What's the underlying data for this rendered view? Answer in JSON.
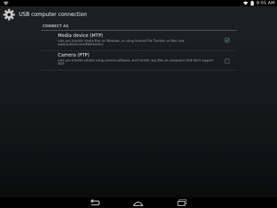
{
  "status_bar": {
    "time": "9:05 AM",
    "wifi_icon": "wifi-icon",
    "battery_icon": "battery-icon"
  },
  "action_bar": {
    "title": "USB computer connection",
    "icon": "settings-gear-icon"
  },
  "section": {
    "header": "CONNECT AS"
  },
  "options": [
    {
      "title": "Media device (MTP)",
      "summary": "Lets you transfer media files on Windows, or using Android File Transfer on Mac (see www.android.com/filetransfer)",
      "checked": true
    },
    {
      "title": "Camera (PTP)",
      "summary": "Lets you transfer photos using camera software, and transfer any files on computers that don't support MTP",
      "checked": false
    }
  ],
  "navigation": {
    "back_icon": "back-icon",
    "home_icon": "home-icon",
    "recents_icon": "recents-icon"
  },
  "colors": {
    "accent": "#33b5e5",
    "action_bar": "#1d1f21",
    "background": "#000000"
  }
}
